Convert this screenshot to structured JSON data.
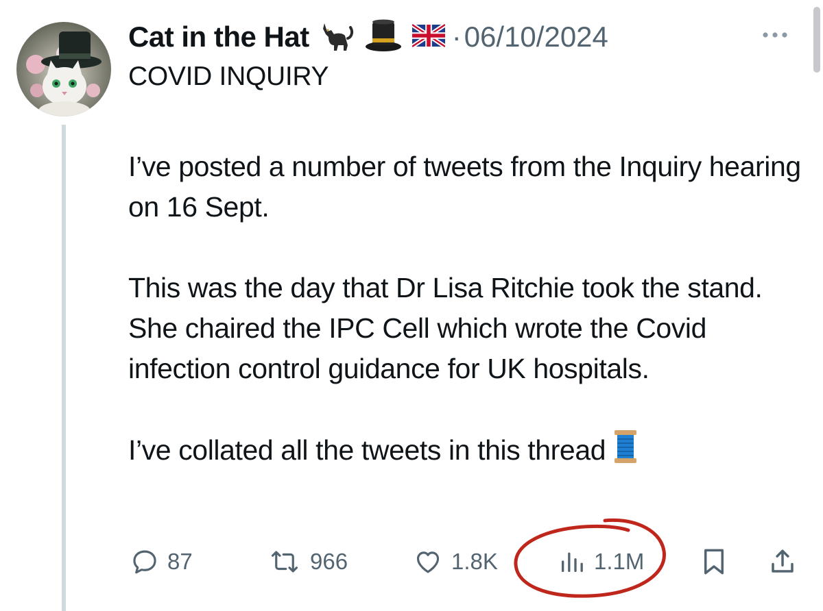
{
  "tweet": {
    "author": {
      "display_name": "Cat in the Hat",
      "name_emojis": [
        "cat-icon",
        "top-hat-icon",
        "uk-flag-icon"
      ],
      "date": "06/10/2024",
      "date_separator": "·"
    },
    "subtitle": "COVID INQUIRY",
    "paragraphs": [
      "I’ve posted a number of tweets from the Inquiry hearing on 16 Sept.",
      "This was the day that Dr Lisa Ritchie took the stand. She chaired the IPC Cell which wrote the Covid infection control guidance for UK hospitals.",
      "I’ve collated all the tweets in this thread"
    ],
    "thread_emoji": "spool-of-thread-icon",
    "metrics": {
      "replies": "87",
      "reposts": "966",
      "likes": "1.8K",
      "views": "1.1M"
    }
  },
  "annotation": {
    "type": "hand-drawn-circle",
    "target": "views",
    "color": "#c0271c"
  },
  "colors": {
    "text": "#0f1419",
    "secondary": "#536471",
    "thread_line": "#cfd9de"
  }
}
